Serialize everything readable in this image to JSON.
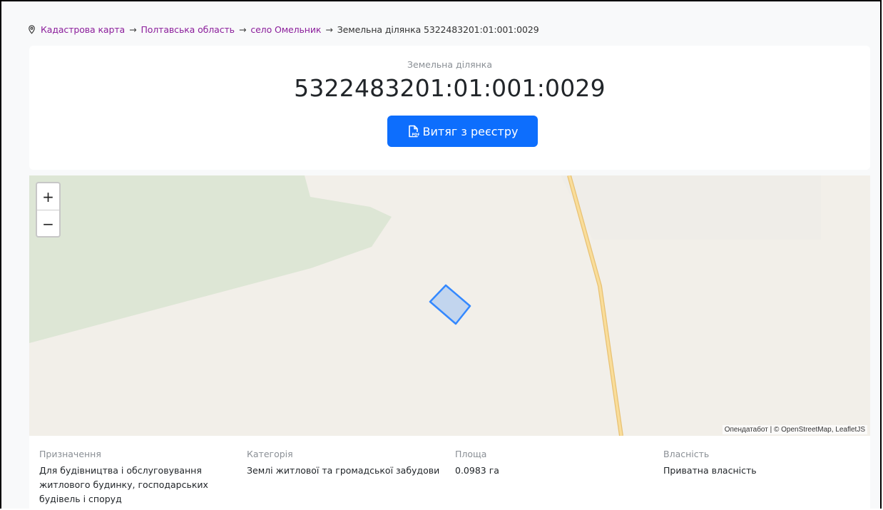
{
  "breadcrumb": {
    "items": [
      "Кадастрова карта",
      "Полтавська область",
      "село Омельник"
    ],
    "separator": "→",
    "current": "Земельна ділянка 5322483201:01:001:0029"
  },
  "header": {
    "kicker": "Земельна ділянка",
    "title": "5322483201:01:001:0029",
    "button_label": "Витяг з реєстру"
  },
  "map": {
    "zoom_in": "+",
    "zoom_out": "−",
    "attribution": "Опендатабот | © OpenStreetMap, LeafletJS",
    "colors": {
      "land": "#f2efe9",
      "forest": "#dde6d5",
      "road": "#f7d48a",
      "parcel": "#3388ff"
    }
  },
  "details": {
    "purpose": {
      "label": "Призначення",
      "value": "Для будівництва і обслуговування житлового будинку, господарських будівель і споруд"
    },
    "category": {
      "label": "Категорія",
      "value": "Землі житлової та громадської забудови"
    },
    "area": {
      "label": "Площа",
      "value": "0.0983 га"
    },
    "ownership": {
      "label": "Власність",
      "value": "Приватна власність"
    }
  },
  "colors": {
    "link": "#8b1d9b",
    "primary": "#0d6efd"
  }
}
